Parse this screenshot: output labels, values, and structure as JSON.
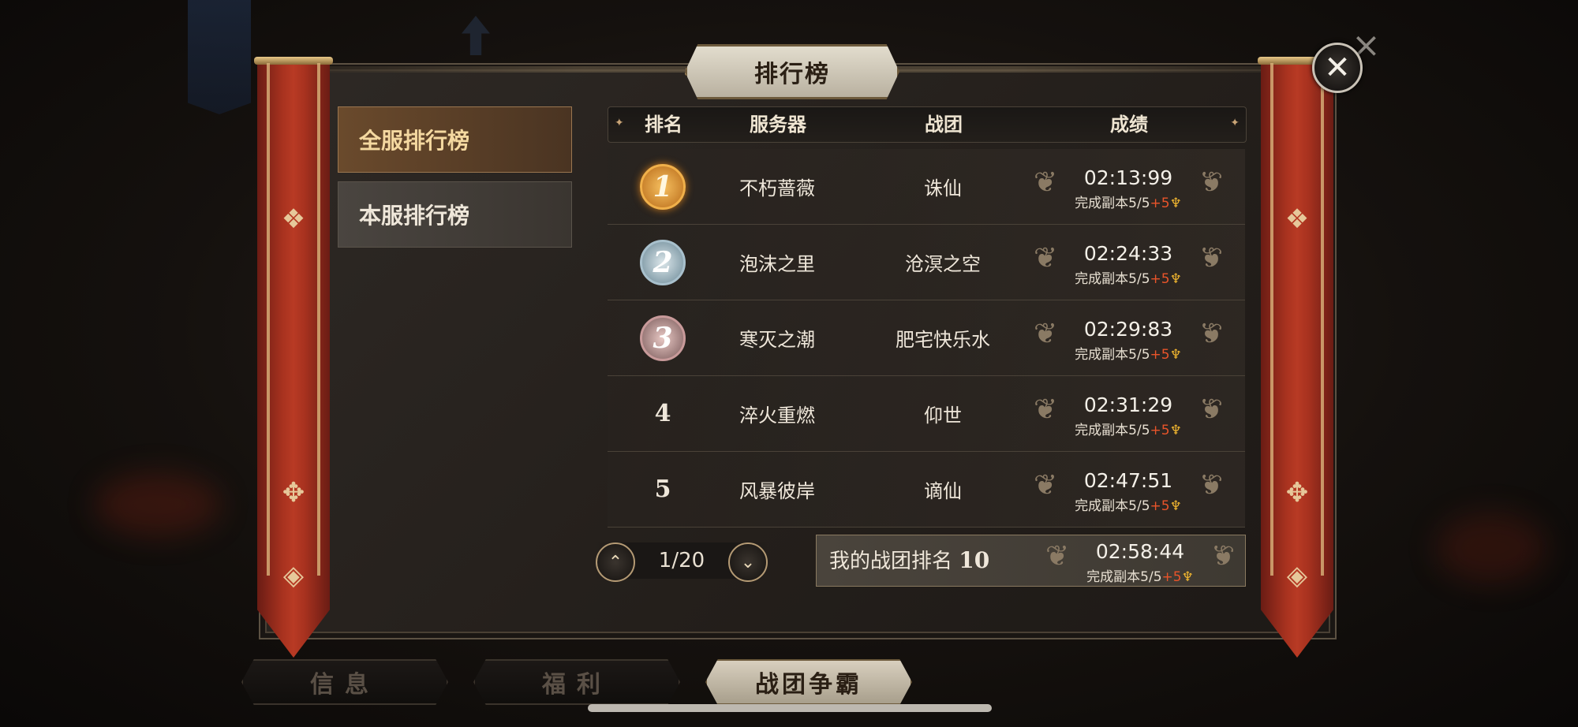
{
  "title": "排行榜",
  "tabs": [
    {
      "label": "全服排行榜",
      "active": true
    },
    {
      "label": "本服排行榜",
      "active": false
    }
  ],
  "table": {
    "headers": [
      "排名",
      "服务器",
      "战团",
      "成绩"
    ],
    "rows": [
      {
        "rank": "1",
        "server": "不朽蔷薇",
        "guild": "诛仙",
        "time": "02:13:99",
        "progress": "完成副本5/5",
        "bonus": "+5"
      },
      {
        "rank": "2",
        "server": "泡沫之里",
        "guild": "沧溟之空",
        "time": "02:24:33",
        "progress": "完成副本5/5",
        "bonus": "+5"
      },
      {
        "rank": "3",
        "server": "寒灭之潮",
        "guild": "肥宅快乐水",
        "time": "02:29:83",
        "progress": "完成副本5/5",
        "bonus": "+5"
      },
      {
        "rank": "4",
        "server": "淬火重燃",
        "guild": "仰世",
        "time": "02:31:29",
        "progress": "完成副本5/5",
        "bonus": "+5"
      },
      {
        "rank": "5",
        "server": "风暴彼岸",
        "guild": "谪仙",
        "time": "02:47:51",
        "progress": "完成副本5/5",
        "bonus": "+5"
      }
    ]
  },
  "pager": {
    "text": "1/20"
  },
  "my_rank": {
    "label": "我的战团排名",
    "value": "10",
    "time": "02:58:44",
    "progress": "完成副本5/5",
    "bonus": "+5"
  },
  "bottom_nav": [
    {
      "label": "信息",
      "active": false
    },
    {
      "label": "福利",
      "active": false
    },
    {
      "label": "战团争霸",
      "active": true
    }
  ],
  "colors": {
    "gold_medal": "#d8902a",
    "silver_medal": "#a8c0cc",
    "bronze_medal": "#c89a9a",
    "accent_red": "#e8542a",
    "trophy": "#f4b830"
  }
}
